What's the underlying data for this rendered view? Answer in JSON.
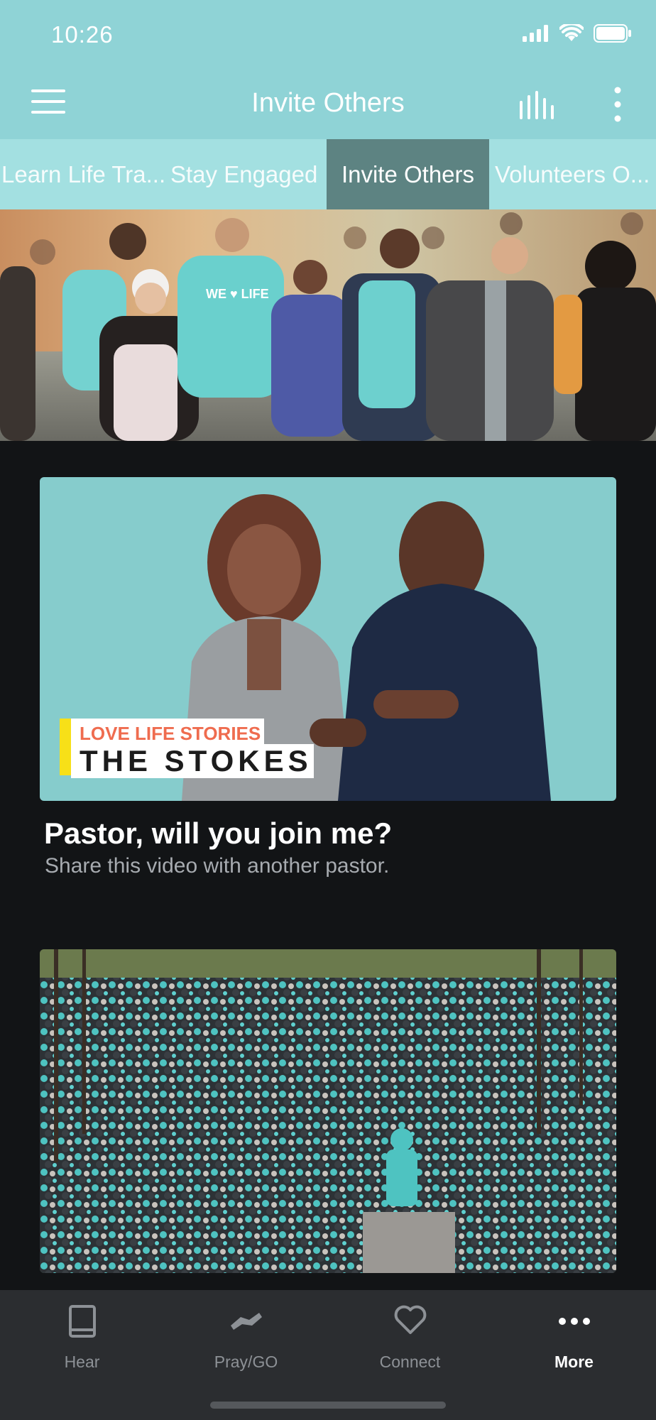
{
  "status_bar": {
    "time": "10:26"
  },
  "header": {
    "title": "Invite Others"
  },
  "tabs": [
    {
      "label": "Learn Life Tra..."
    },
    {
      "label": "Stay Engaged"
    },
    {
      "label": "Invite Others",
      "active": true
    },
    {
      "label": "Volunteers O..."
    }
  ],
  "hero": {
    "shirt_text": "WE ♥ LIFE"
  },
  "cards": [
    {
      "overlay_kicker": "LOVE LIFE STORIES",
      "overlay_title": "THE STOKES",
      "title": "Pastor, will you join me?",
      "subtitle": "Share this video with another pastor."
    },
    {
      "title": "",
      "subtitle": ""
    }
  ],
  "bottom_nav": [
    {
      "label": "Hear",
      "icon": "book-icon"
    },
    {
      "label": "Pray/GO",
      "icon": "handshake-icon"
    },
    {
      "label": "Connect",
      "icon": "heart-icon"
    },
    {
      "label": "More",
      "icon": "more-horizontal-icon",
      "active": true
    }
  ],
  "colors": {
    "accent": "#8fd3d6",
    "tab_active": "#5d8382",
    "background": "#121416",
    "nav_background": "#2b2d30"
  }
}
